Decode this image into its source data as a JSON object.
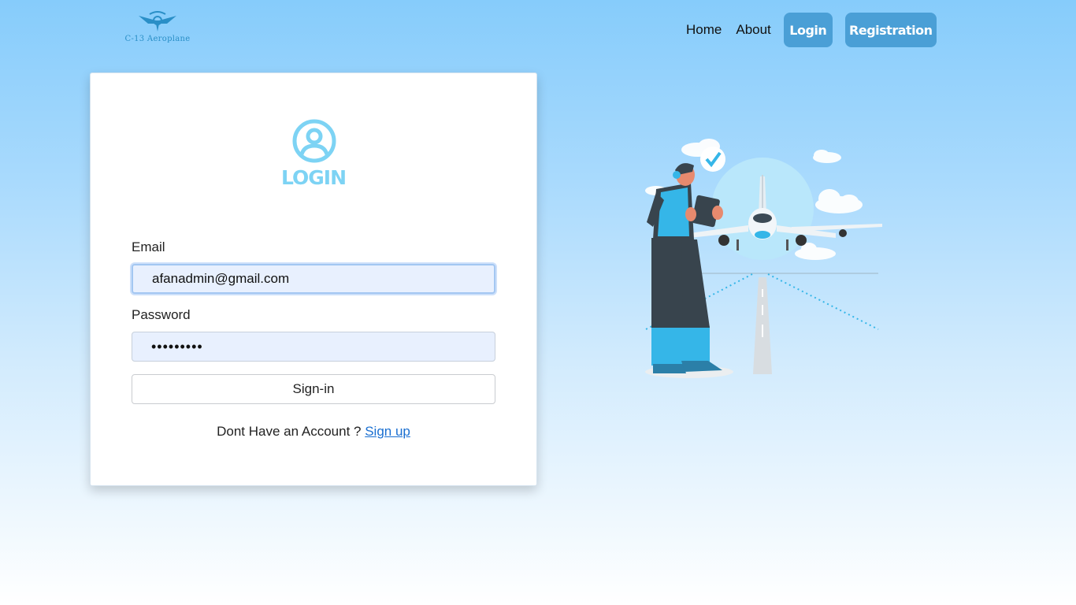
{
  "brand": {
    "name": "C-13 Aeroplane"
  },
  "nav": {
    "home": "Home",
    "about": "About",
    "login": "Login",
    "registration": "Registration"
  },
  "login_form": {
    "title": "LOGIN",
    "email_label": "Email",
    "email_value": "afanadmin@gmail.com",
    "password_label": "Password",
    "password_value": "•••••••••",
    "signin_label": "Sign-in",
    "signup_prompt": "Dont Have an Account ?",
    "signup_link": "Sign up"
  },
  "colors": {
    "accent": "#7dd3f4",
    "nav_button": "#4a9fd6",
    "link": "#1a6fd1"
  },
  "icons": [
    "logo-icon",
    "user-circle-icon",
    "airport-illustration"
  ]
}
